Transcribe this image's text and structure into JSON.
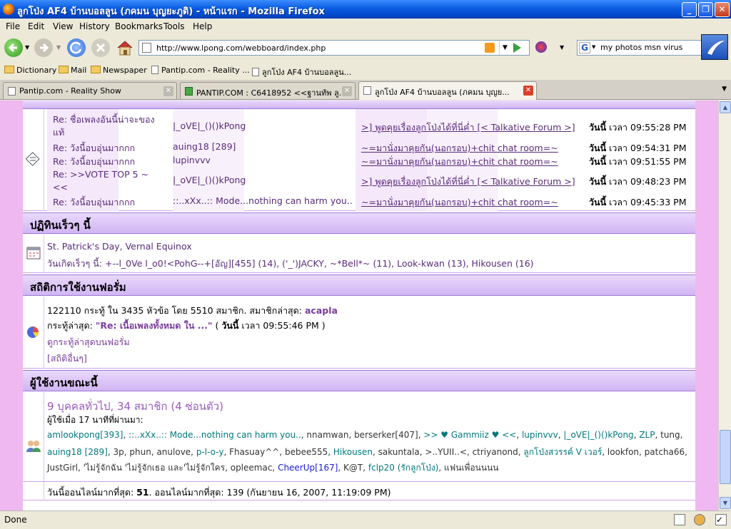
{
  "window": {
    "title": "ลูกโป่ง AF4 บ้านบอลลูน (ภคมน บุญยะภูติ) - หน้าแรก - Mozilla Firefox"
  },
  "menu": [
    "File",
    "Edit",
    "View",
    "History",
    "Bookmarks",
    "Tools",
    "Help"
  ],
  "nav": {
    "url": "http://www.lpong.com/webboard/index.php",
    "search_value": "my photos msn virus",
    "search_engine": "G"
  },
  "bookmarks": [
    "Dictionary",
    "Mail",
    "Newspaper",
    "Pantip.com - Reality ...",
    "ลูกโป่ง AF4 บ้านบอลลูน..."
  ],
  "tabs": [
    "Pantip.com - Reality Show",
    "PANTIP.COM : C6418952 <<ฐานทัพ ลู...",
    "ลูกโป่ง AF4 บ้านบอลลูน (ภคมน บุญย..."
  ],
  "recent_posts": [
    {
      "title": "Re: ชื่อเพลงอันนี้น่าจะของแท้",
      "user": "|_oVE|_()()kPong",
      "forum": ">] พูดคุยเรื่องลูกโป่งได้ที่นี่ค่ำ [< Talkative Forum >]",
      "today": "วันนี้",
      "time": "เวลา 09:55:28 PM"
    },
    {
      "title": "Re: วังนี้อบอุ่นมากกก",
      "user": "auing18 [289]",
      "forum": "~=มานั่งมาคุยกัน(นอกรอบ)+chit chat room=~",
      "today": "วันนี้",
      "time": "เวลา 09:54:31 PM"
    },
    {
      "title": "Re: วังนี้อบอุ่นมากกก",
      "user": "lupinvvv",
      "forum": "~=มานั่งมาคุยกัน(นอกรอบ)+chit chat room=~",
      "today": "วันนี้",
      "time": "เวลา 09:51:55 PM"
    },
    {
      "title": "Re: >>VOTE TOP 5 ~ <<",
      "user": "|_oVE|_()()kPong",
      "forum": ">] พูดคุยเรื่องลูกโป่งได้ที่นี่ค่ำ [< Talkative Forum >]",
      "today": "วันนี้",
      "time": "เวลา 09:48:23 PM"
    },
    {
      "title": "Re: วังนี้อบอุ่นมากกก",
      "user": "::..xXx..:: Mode...nothing can harm you..",
      "forum": "~=มานั่งมาคุยกัน(นอกรอบ)+chit chat room=~",
      "today": "วันนี้",
      "time": "เวลา 09:45:33 PM"
    }
  ],
  "calendar": {
    "heading": "ปฏิทินเร็วๆ นี้",
    "event": "St. Patrick's Day, Vernal Equinox",
    "birthdays_label": "วันเกิดเร็วๆ นี้:",
    "birthdays": "+--l_0Ve l_o0!<PohG--+[อัญ][455] (14), ('_')JACKY, ~*Bell*~ (11), Look-kwan (13), Hikousen (16)"
  },
  "stats": {
    "heading": "สถิติการใช้งานฟอรั่ม",
    "line1_prefix": "122110 กระทู้ ใน 3435 หัวข้อ โดย 5510 สมาชิก. สมาชิกล่าสุด:",
    "latest_member": "acapla",
    "line2_prefix": "กระทู้ล่าสุด:",
    "latest_post": "\"Re: เนื้อเพลงทั้งหมด ใน ...\"",
    "latest_post_time_prefix": "( ",
    "latest_post_today": "วันนี้",
    "latest_post_time": "เวลา 09:55:46 PM )",
    "link_recent": "ดูกระทู้ล่าสุดบนฟอรั่ม",
    "link_more": "[สถิติอื่นๆ]"
  },
  "online": {
    "heading": "ผู้ใช้งานขณะนี้",
    "summary": "9 บุคคลทั่วไป, 34 สมาชิก (4 ซ่อนตัว)",
    "recent_label": "ผู้ใช้เมื่อ 17 นาทีที่ผ่านมา:",
    "line1": [
      {
        "t": "amlookpong[393]",
        "c": "teal"
      },
      {
        "t": ", ",
        "c": "plain"
      },
      {
        "t": "::..xXx..:: Mode...nothing can harm you..",
        "c": "teal"
      },
      {
        "t": ", nnamwan, berserker[407], ",
        "c": "plain"
      },
      {
        "t": ">> ♥ Gammiiz ♥ <<",
        "c": "teal"
      },
      {
        "t": ", ",
        "c": "plain"
      },
      {
        "t": "lupinvvv",
        "c": "teal"
      },
      {
        "t": ", ",
        "c": "plain"
      },
      {
        "t": "|_oVE|_()()kPong",
        "c": "teal"
      },
      {
        "t": ", ",
        "c": "plain"
      },
      {
        "t": "ZLP",
        "c": "teal"
      },
      {
        "t": ", tung,",
        "c": "plain"
      }
    ],
    "line2": [
      {
        "t": "auing18 [289]",
        "c": "teal"
      },
      {
        "t": ", 3p, phun, anulove, ",
        "c": "plain"
      },
      {
        "t": "p-l-o-y",
        "c": "teal"
      },
      {
        "t": ", Fhasuay^^, bebee555, ",
        "c": "plain"
      },
      {
        "t": "Hikousen",
        "c": "teal"
      },
      {
        "t": ", sakuntala, >..YUII..<, ctriyanond, ",
        "c": "plain"
      },
      {
        "t": "ลูกโป่งสวรรค์ V เวอร์",
        "c": "teal"
      },
      {
        "t": ", lookfon, patcha66,",
        "c": "plain"
      }
    ],
    "line3": [
      {
        "t": "JustGirl, 'ไม่รู้จักฉัน 'ไม่รู้จักเธอ และ'ไม่รู้จักใคร, opleemac, ",
        "c": "plain"
      },
      {
        "t": "CheerUp[167]",
        "c": "blue"
      },
      {
        "t": ", K@T, ",
        "c": "plain"
      },
      {
        "t": "fclp20 (รักลูกโป่ง)",
        "c": "teal"
      },
      {
        "t": ", แฟนเพื่อนนนน",
        "c": "plain"
      }
    ],
    "record_prefix": "วันนี้ออนไลน์มากที่สุด:",
    "record_today": "51",
    "record_mid": ". ออนไลน์มากที่สุด: 139 (กันยายน 16, 2007, 11:19:09 PM)"
  },
  "status": "Done"
}
